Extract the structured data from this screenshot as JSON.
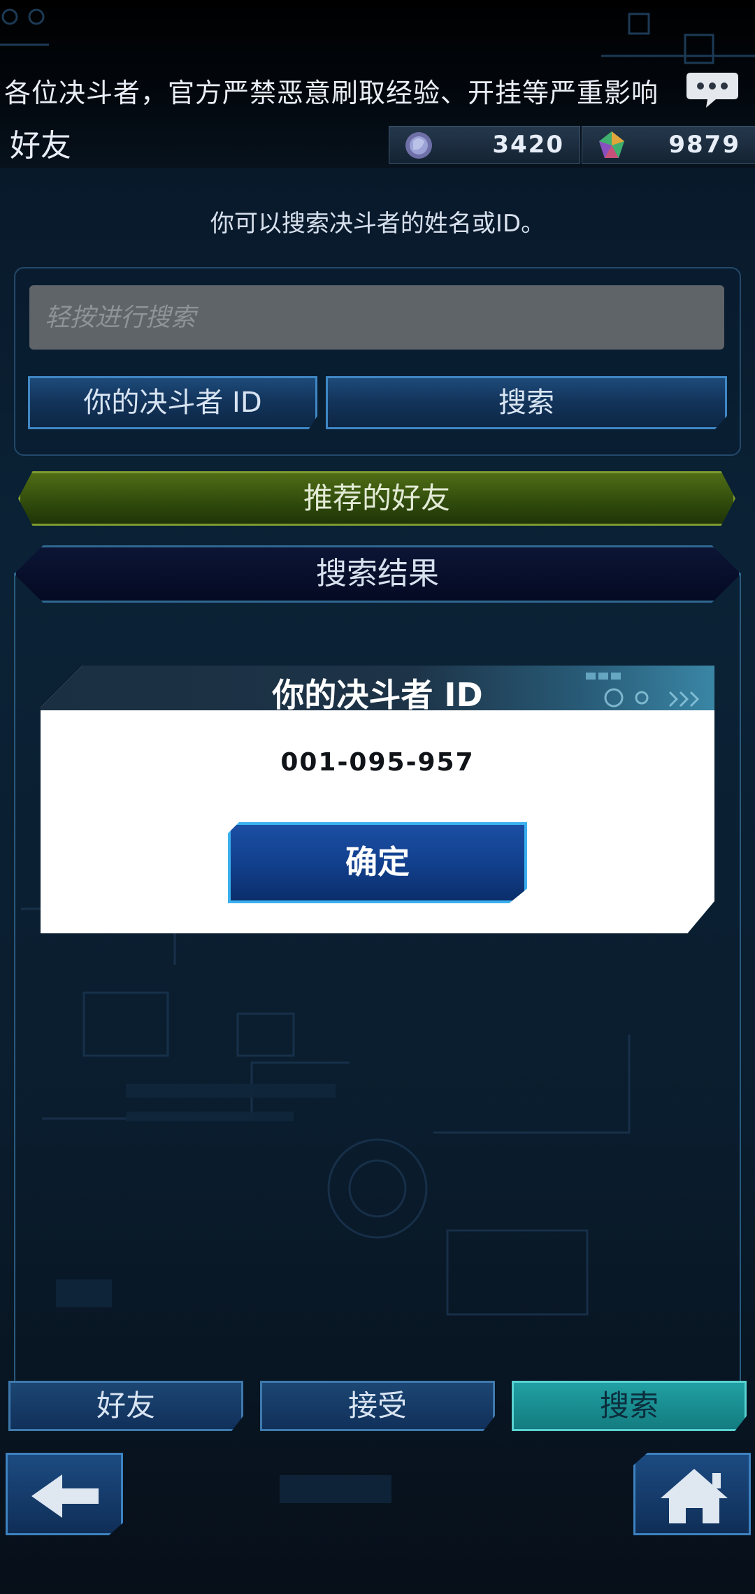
{
  "header": {
    "ticker_text": "各位决斗者，官方严禁恶意刷取经验、开挂等严重影响",
    "title": "好友",
    "chat_icon": "chat-bubble-icon",
    "currencies": [
      {
        "icon": "orb-icon",
        "value": "3420"
      },
      {
        "icon": "gem-icon",
        "value": "9879"
      }
    ]
  },
  "search": {
    "hint": "你可以搜索决斗者的姓名或ID。",
    "placeholder": "轻按进行搜索",
    "your_id_button": "你的决斗者 ID",
    "search_button": "搜索"
  },
  "recommended_label": "推荐的好友",
  "results_label": "搜索结果",
  "dialog": {
    "title": "你的决斗者 ID",
    "value": "001-095-957",
    "confirm_label": "确定"
  },
  "tabs": [
    {
      "label": "好友",
      "active": false
    },
    {
      "label": "接受",
      "active": false
    },
    {
      "label": "搜索",
      "active": true
    }
  ],
  "nav": {
    "back_icon": "arrow-left-icon",
    "home_icon": "home-icon"
  }
}
